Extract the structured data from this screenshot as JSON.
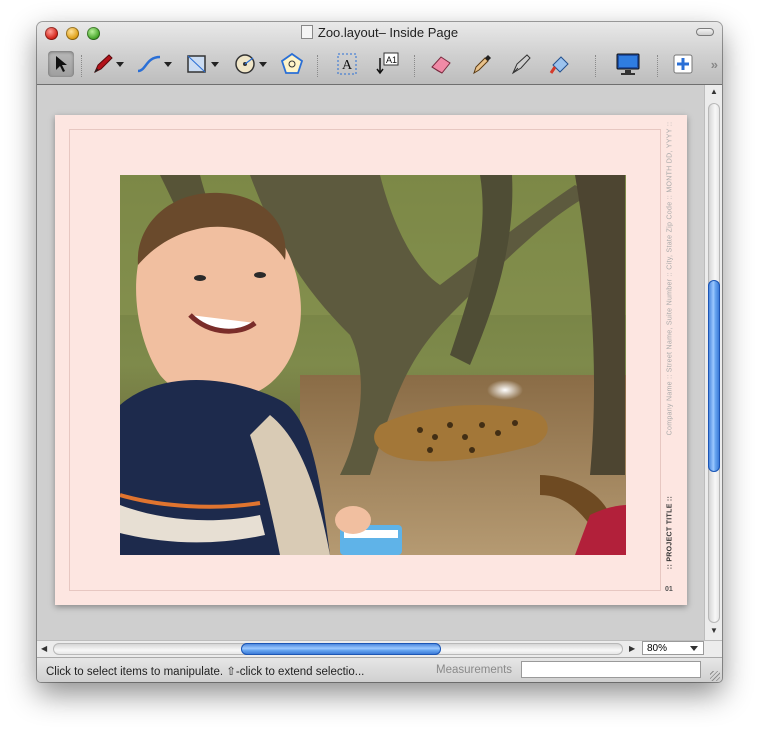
{
  "window": {
    "title": "Zoo.layout– Inside Page"
  },
  "toolbar": {
    "tools": [
      "selection-tool",
      "pen-tool",
      "bezier-tool",
      "rectangle-tool",
      "oval-tool",
      "polygon-tool",
      "text-tool",
      "text-link-tool",
      "eraser-tool",
      "eyedropper-tool",
      "pen-nib-tool",
      "paint-bucket-tool",
      "display-tool",
      "add-page-tool"
    ]
  },
  "page": {
    "side_text": "Company Name  ::  Street Name, Suite Number  ::  City, State Zip Code  ::  MONTH DD, YYYY  ::",
    "project_title": "::  PROJECT TITLE  ::",
    "page_number": "01"
  },
  "scroll": {
    "vertical_position": 0.34,
    "vertical_visible": 0.37,
    "horizontal_position": 0.33,
    "horizontal_visible": 0.35
  },
  "zoom": {
    "value": "80%"
  },
  "status": {
    "hint": "Click to select items to manipulate. ⇧-click to extend selectio...",
    "measurements_label": "Measurements",
    "measurements_value": ""
  },
  "colors": {
    "page_background": "#fde6e1",
    "scroll_accent": "#3a7ad8"
  }
}
